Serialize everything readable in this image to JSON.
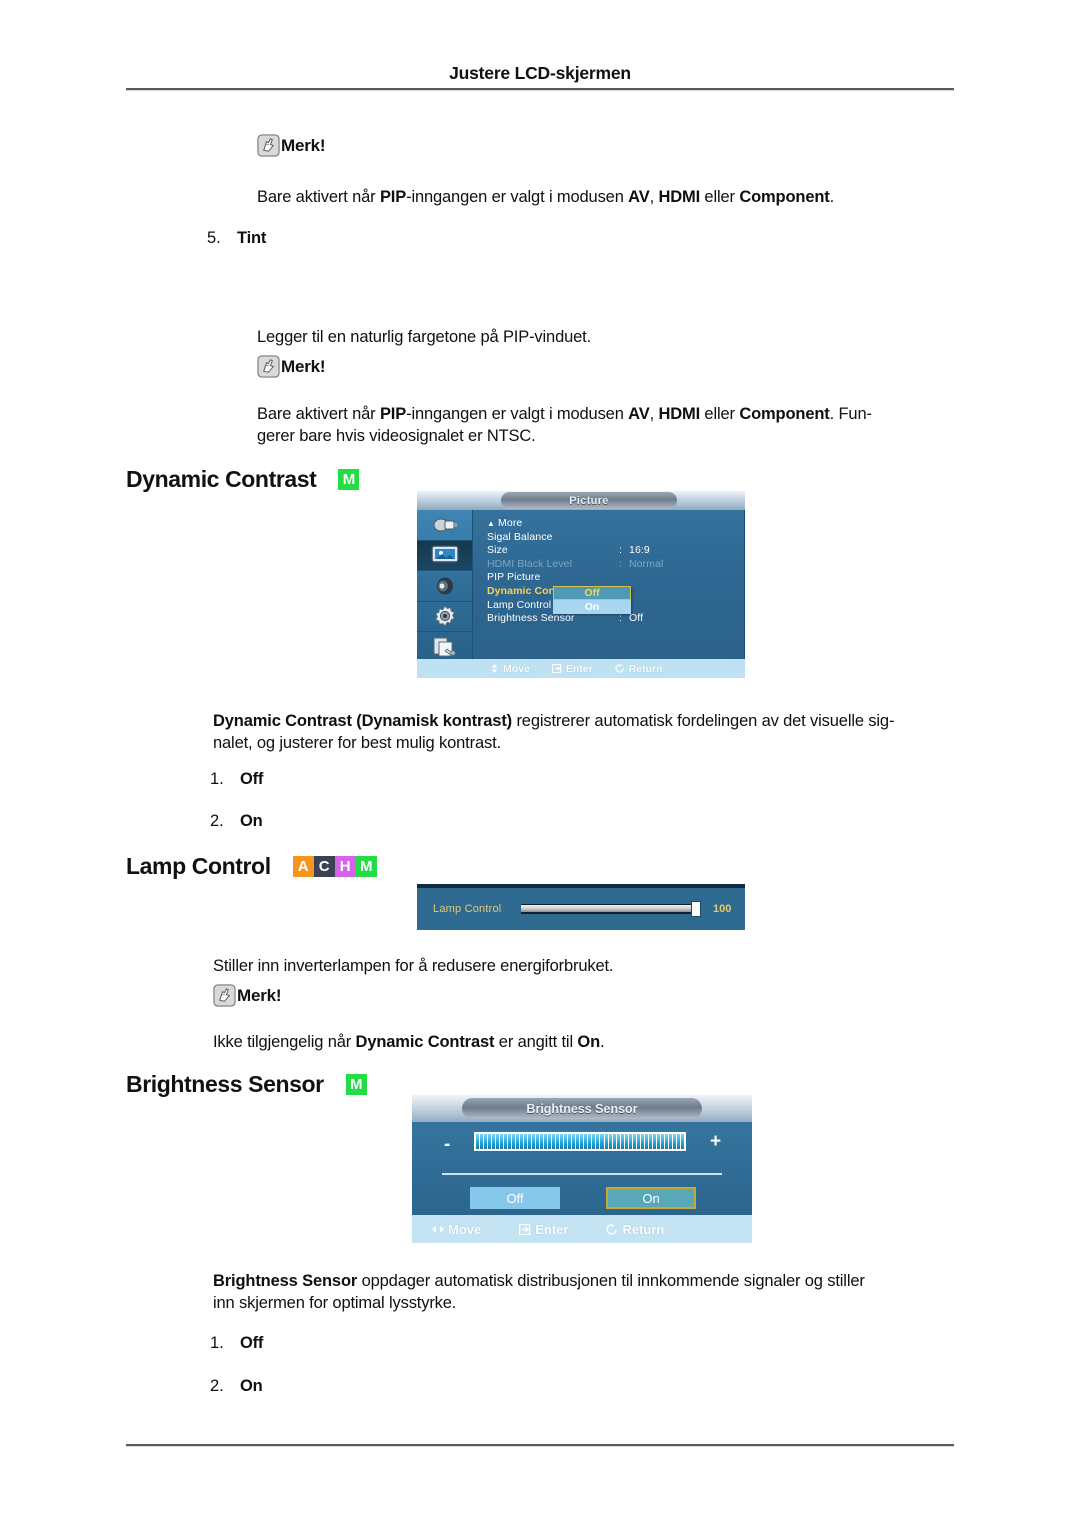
{
  "header": {
    "title": "Justere LCD-skjermen"
  },
  "notes": {
    "label": "Merk!",
    "icon": "note-hand-icon"
  },
  "sections": {
    "pip_note": {
      "text_prefix": "Bare aktivert når ",
      "b1": "PIP",
      "mid1": "-inngangen er valgt i modusen ",
      "b2": "AV",
      "mid2": ", ",
      "b3": "HDMI",
      "mid3": " eller ",
      "b4": "Component",
      "suffix": "."
    },
    "tint": {
      "number": "5.",
      "label": "Tint",
      "description": "Legger til en naturlig fargetone på PIP-vinduet.",
      "note_prefix": "Bare aktivert når ",
      "note_b1": "PIP",
      "note_mid1": "-inngangen er valgt i modusen ",
      "note_b2": "AV",
      "note_mid2": ", ",
      "note_b3": "HDMI",
      "note_mid3": " eller ",
      "note_b4": "Component",
      "note_suffix": ". Fun-",
      "note_line2": "gerer bare hvis videosignalet er NTSC."
    },
    "dynamic_contrast": {
      "heading": "Dynamic Contrast",
      "badges": [
        {
          "letter": "M",
          "color": "#22dd44"
        }
      ],
      "description_b": "Dynamic Contrast (Dynamisk kontrast)",
      "description_rest": " registrerer automatisk fordelingen av det visuelle sig-",
      "description_line2": "nalet, og justerer for best mulig kontrast.",
      "options": [
        {
          "number": "1.",
          "label": "Off"
        },
        {
          "number": "2.",
          "label": "On"
        }
      ]
    },
    "lamp_control": {
      "heading": "Lamp Control",
      "badges": [
        {
          "letter": "A",
          "color": "#f7941e"
        },
        {
          "letter": "C",
          "color": "#3b4256"
        },
        {
          "letter": "H",
          "color": "#d664e8"
        },
        {
          "letter": "M",
          "color": "#22dd44"
        }
      ],
      "description": "Stiller inn inverterlampen for å redusere energiforbruket.",
      "note_prefix": "Ikke tilgjengelig når ",
      "note_b1": "Dynamic Contrast",
      "note_mid": " er angitt til ",
      "note_b2": "On",
      "note_suffix": "."
    },
    "brightness_sensor": {
      "heading": "Brightness Sensor",
      "badges": [
        {
          "letter": "M",
          "color": "#22dd44"
        }
      ],
      "description_b": "Brightness Sensor",
      "description_rest": " oppdager automatisk distribusjonen til innkommende signaler og stiller",
      "description_line2": "inn skjermen for optimal lysstyrke.",
      "options": [
        {
          "number": "1.",
          "label": "Off"
        },
        {
          "number": "2.",
          "label": "On"
        }
      ]
    }
  },
  "osd_picture": {
    "title": "Picture",
    "sidebar_icons": [
      "input-plug-icon",
      "picture-screen-icon",
      "sound-speaker-icon",
      "setup-gear-icon",
      "multi-control-icon"
    ],
    "rows": [
      {
        "label": "More",
        "value": "",
        "caret": "▲",
        "state": "normal"
      },
      {
        "label": "Sigal Balance",
        "value": "",
        "state": "normal"
      },
      {
        "label": "Size",
        "value": "16:9",
        "colon": ":",
        "state": "normal"
      },
      {
        "label": "HDMI Black Level",
        "value": "Normal",
        "colon": ":",
        "state": "dim"
      },
      {
        "label": "PIP Picture",
        "value": "",
        "state": "normal"
      },
      {
        "label": "Dynamic Contrast",
        "value": "",
        "colon": ":",
        "state": "active"
      },
      {
        "label": "Lamp Control",
        "value": "",
        "colon": ":",
        "state": "normal"
      },
      {
        "label": "Brightness Sensor",
        "value": "Off",
        "colon": ":",
        "state": "normal"
      }
    ],
    "popup": {
      "selected": "Off",
      "other": "On"
    },
    "footer": [
      {
        "icon": "move-updown-icon",
        "label": "Move"
      },
      {
        "icon": "enter-icon",
        "label": "Enter"
      },
      {
        "icon": "return-icon",
        "label": "Return"
      }
    ]
  },
  "osd_lamp": {
    "label": "Lamp Control",
    "value": "100"
  },
  "osd_brightness_sensor": {
    "title": "Brightness Sensor",
    "minus": "-",
    "plus": "+",
    "buttons": [
      {
        "label": "Off",
        "state": "normal"
      },
      {
        "label": "On",
        "state": "selected"
      }
    ],
    "footer": [
      {
        "icon": "move-leftright-icon",
        "label": "Move"
      },
      {
        "icon": "enter-icon",
        "label": "Enter"
      },
      {
        "icon": "return-icon",
        "label": "Return"
      }
    ]
  }
}
